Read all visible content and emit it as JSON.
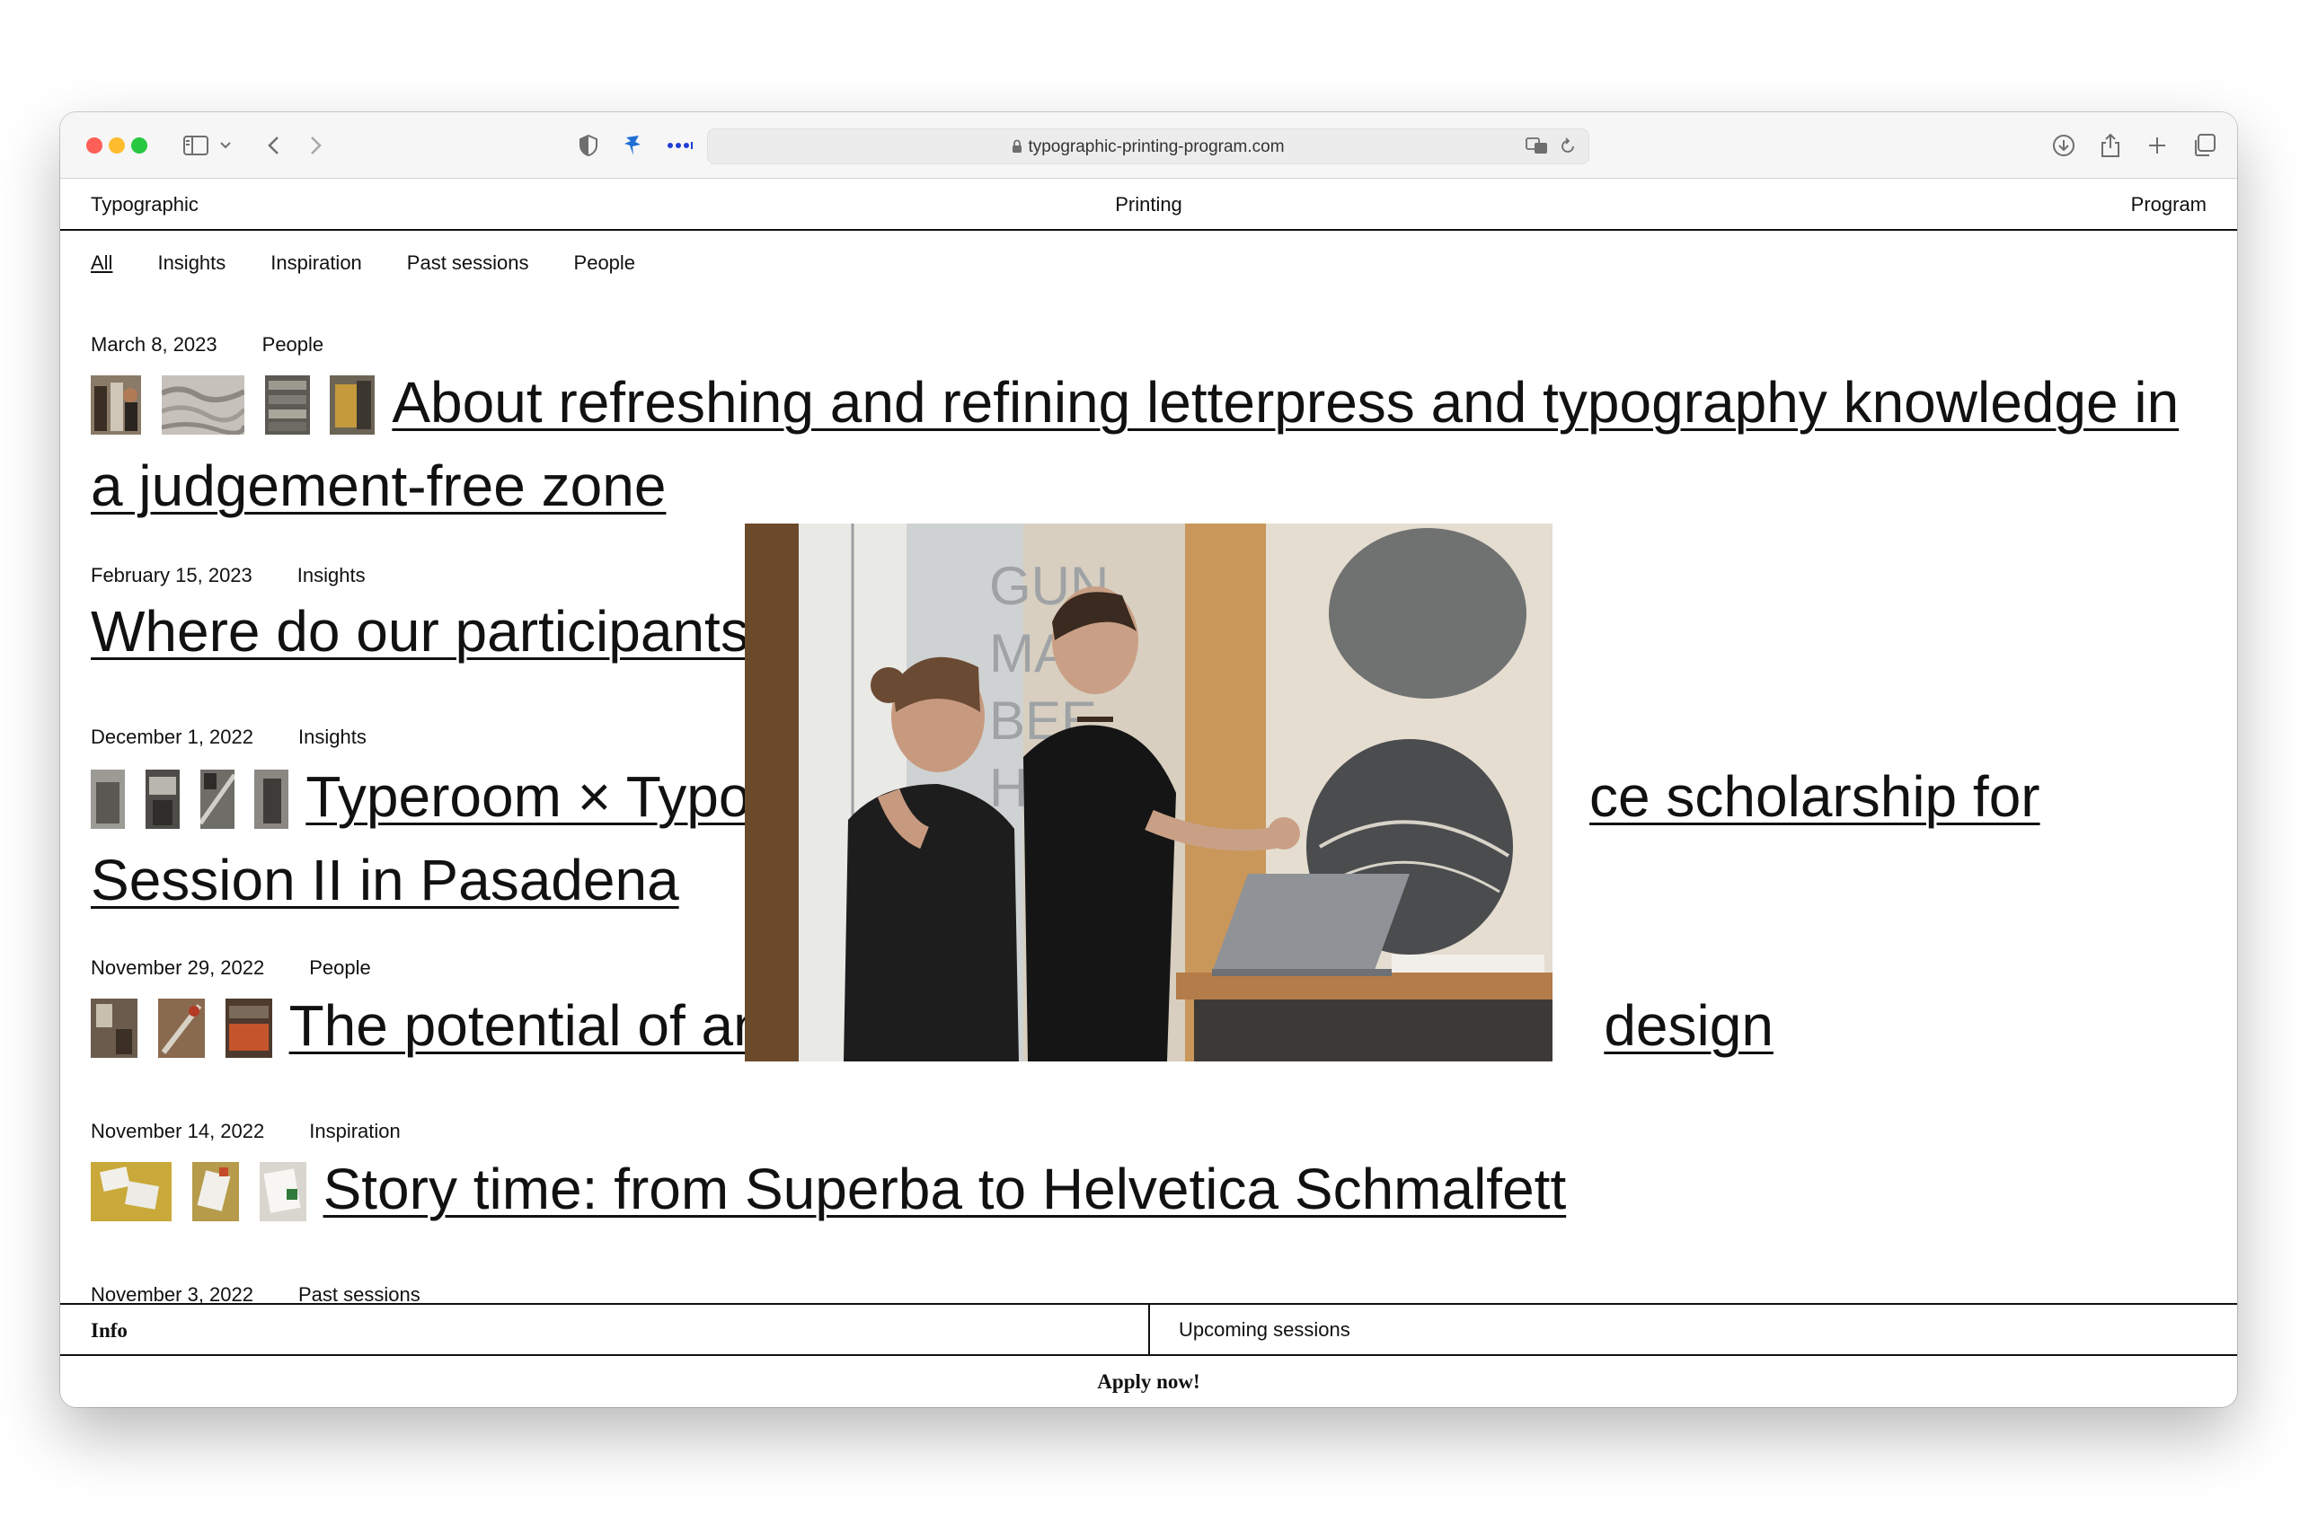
{
  "browser": {
    "url": "typographic-printing-program.com",
    "icons": [
      "sidebar-icon",
      "chevron-down-icon",
      "back-icon",
      "forward-icon",
      "shield-icon",
      "extension-icon",
      "more-icon",
      "lock-icon",
      "translate-icon",
      "reload-icon",
      "download-icon",
      "share-icon",
      "new-tab-icon",
      "tabs-overview-icon"
    ]
  },
  "header": {
    "left": "Typographic",
    "center": "Printing",
    "right": "Program"
  },
  "filters": [
    "All",
    "Insights",
    "Inspiration",
    "Past sessions",
    "People"
  ],
  "posts": [
    {
      "date": "March 8, 2023",
      "category": "People",
      "title_line1": "About refreshing and refining letterpress and typography knowledge in",
      "title_line2": "a judgement-free zone"
    },
    {
      "date": "February 15, 2023",
      "category": "Insights",
      "title_line1": "Where do our participants"
    },
    {
      "date": "December 1, 2022",
      "category": "Insights",
      "title_line1_a": "Typeroom × Typog",
      "title_line1_b": "ce scholarship for",
      "title_line2": "Session II in Pasadena"
    },
    {
      "date": "November 29, 2022",
      "category": "People",
      "title_a": "The potential of ana",
      "title_b": "design"
    },
    {
      "date": "November 14, 2022",
      "category": "Inspiration",
      "title_line1": "Story time: from Superba to Helvetica Schmalfett"
    },
    {
      "date": "November 3, 2022",
      "category": "Past sessions"
    }
  ],
  "photo": {
    "wall_text": [
      "GUN",
      "MAN",
      "BEE",
      "HUR"
    ]
  },
  "footer": {
    "info": "Info",
    "upcoming": "Upcoming sessions",
    "apply": "Apply now!"
  }
}
